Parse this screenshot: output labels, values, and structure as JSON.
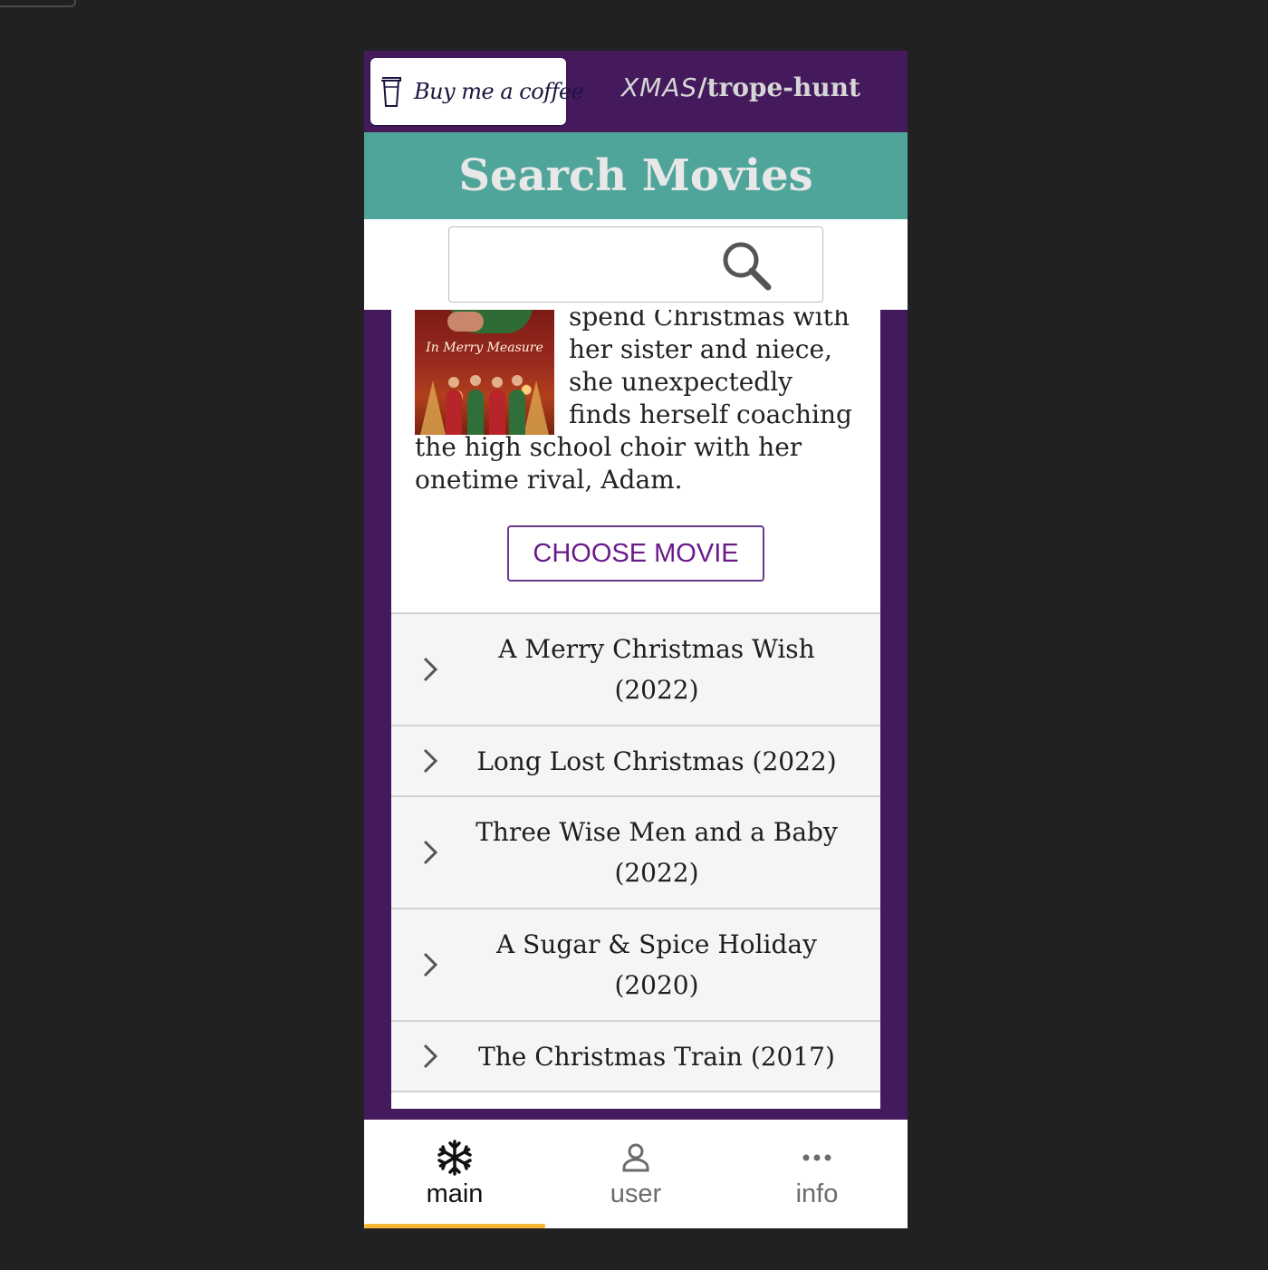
{
  "header": {
    "coffee_label": "Buy me a coffee",
    "brand_xmas": "XMAS",
    "brand_rest": "/trope-hunt"
  },
  "search": {
    "title": "Search Movies",
    "value": "",
    "placeholder": ""
  },
  "featured": {
    "poster_title": "In Merry Measure",
    "description_partial": "spend Christmas with her sister and niece, she unexpectedly finds herself coaching the high school choir with her onetime rival, Adam.",
    "choose_label": "CHOOSE MOVIE"
  },
  "movies": [
    {
      "label": "A Merry Christmas Wish (2022)"
    },
    {
      "label": "Long Lost Christmas (2022)"
    },
    {
      "label": "Three Wise Men and a Baby (2022)"
    },
    {
      "label": "A Sugar & Spice Holiday (2020)"
    },
    {
      "label": "The Christmas Train (2017)"
    }
  ],
  "nav": {
    "items": [
      {
        "label": "main",
        "icon": "snowflake-icon"
      },
      {
        "label": "user",
        "icon": "user-icon"
      },
      {
        "label": "info",
        "icon": "more-icon"
      }
    ],
    "active": "main"
  },
  "colors": {
    "brand_purple": "#441a5c",
    "teal_header": "#50a59a",
    "active_underline": "#f7b733",
    "button_text": "#6a1b8a"
  }
}
